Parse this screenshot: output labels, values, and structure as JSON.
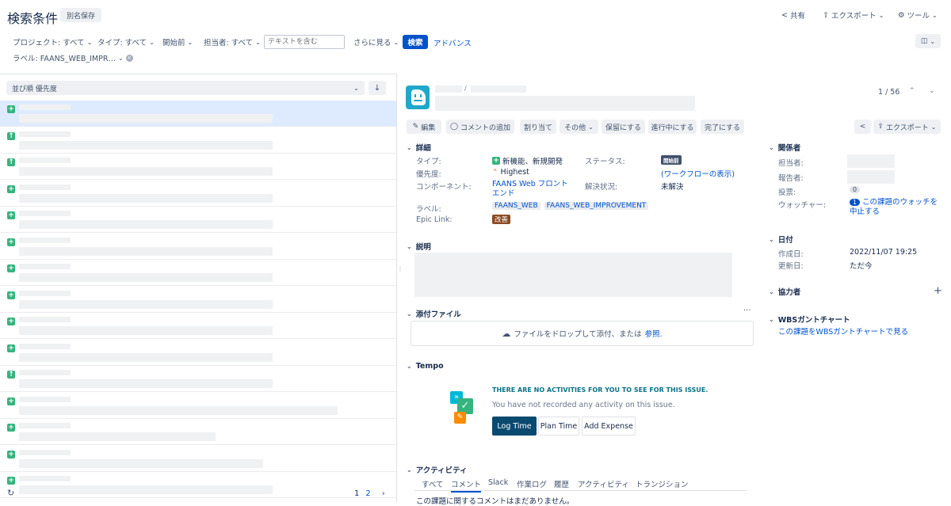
{
  "header": {
    "title": "検索条件",
    "save_as": "別名保存",
    "share": "共有",
    "export": "エクスポート",
    "tools": "ツール"
  },
  "filters": {
    "project": "プロジェクト: すべて",
    "type": "タイプ: すべて",
    "start": "開始前",
    "assignee": "担当者: すべて",
    "text_placeholder": "テキストを含む",
    "more": "さらに見る",
    "search": "検索",
    "advanced": "アドバンス",
    "label": "ラベル: FAANS_WEB_IMPR…"
  },
  "list": {
    "sort": "並び順 優先度",
    "pages": [
      "1",
      "2"
    ]
  },
  "issue": {
    "counter": "1 / 56",
    "toolbar": {
      "edit": "編集",
      "comment": "コメントの追加",
      "assign": "割り当て",
      "other": "その他",
      "hold": "保留にする",
      "in_progress": "進行中にする",
      "done": "完了にする",
      "export": "エクスポート"
    },
    "details": {
      "heading": "詳細",
      "type_label": "タイプ:",
      "type_value": "新機能、新規開発",
      "status_label": "ステータス:",
      "status_value": "開始前",
      "priority_label": "優先度:",
      "priority_value": "Highest",
      "workflow_link": "(ワークフローの表示)",
      "component_label": "コンポーネント:",
      "component_value": "FAANS Web フロント エンド",
      "resolution_label": "解決状況:",
      "resolution_value": "未解決",
      "labels_label": "ラベル:",
      "labels": [
        "FAANS_WEB",
        "FAANS_WEB_IMPROVEMENT"
      ],
      "epic_label": "Epic Link:",
      "epic_value": "改善"
    },
    "description_heading": "説明",
    "attachments": {
      "heading": "添付ファイル",
      "drop_text": "ファイルをドロップして添付、または",
      "browse": "参照."
    },
    "tempo": {
      "heading": "Tempo",
      "title": "THERE ARE NO ACTIVITIES FOR YOU TO SEE FOR THIS ISSUE.",
      "subtitle": "You have not recorded any activity on this issue.",
      "log_time": "Log Time",
      "plan_time": "Plan Time",
      "add_expense": "Add Expense"
    },
    "activity": {
      "heading": "アクティビティ",
      "tabs": [
        "すべて",
        "コメント",
        "Slack",
        "作業ログ",
        "履歴",
        "アクティビティ",
        "トランジション"
      ],
      "empty": "この課題に関するコメントはまだありません。"
    },
    "people": {
      "heading": "関係者",
      "assignee_label": "担当者:",
      "reporter_label": "報告者:",
      "votes_label": "投票:",
      "votes_value": "0",
      "watchers_label": "ウォッチャー:",
      "watchers_count": "1",
      "watch_link": "この課題のウォッチを中止する"
    },
    "dates": {
      "heading": "日付",
      "created_label": "作成日:",
      "created_value": "2022/11/07 19:25",
      "updated_label": "更新日:",
      "updated_value": "ただ今"
    },
    "collaborators_heading": "協力者",
    "wbs": {
      "heading": "WBSガントチャート",
      "link": "この課題をWBSガントチャートで見る"
    }
  },
  "colors": {
    "primary": "#0052cc",
    "green": "#36b37e",
    "brown": "#8b4a23",
    "tempo_dark": "#0b4a6f"
  }
}
